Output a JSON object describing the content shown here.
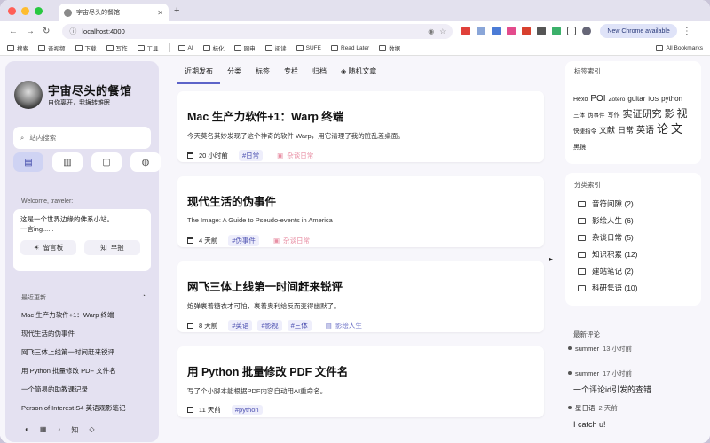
{
  "browser": {
    "tab_title": "宇宙尽头的餐馆",
    "url": "localhost:4000",
    "new_chrome_label": "New Chrome available",
    "lights": [
      "#ff5f57",
      "#febc2e",
      "#28c840"
    ],
    "bookmarks": [
      "搜索",
      "音视频",
      "下载",
      "写作",
      "工具",
      "AI",
      "标化",
      "网申",
      "阅读",
      "SUFE",
      "Read Later",
      "数据"
    ],
    "all_bookmarks": "All Bookmarks"
  },
  "sidebar": {
    "site_name": "宇宙尽头的餐馆",
    "site_sub": "自你离开，我辗转难眠",
    "search_placeholder": "站内搜索",
    "welcome": "Welcome, traveler:",
    "card_line1": "这是一个世界边缘的佛系小站。",
    "card_line2": "一言ing......",
    "btn_guestbook": "留言板",
    "btn_zhihu": "早报",
    "zhihu_icon_text": "知",
    "recent_title": "最近更新",
    "recent": [
      "Mac 生产力软件+1：Warp 终端",
      "现代生活的伪事件",
      "网飞三体上线第一时间赶来锐评",
      "用 Python 批量修改 PDF 文件名",
      "一个简易的助教课记录",
      "Person of Interest S4 英语观影笔记"
    ]
  },
  "tabs": [
    "近期发布",
    "分类",
    "标签",
    "专栏",
    "归档",
    "随机文章"
  ],
  "posts": [
    {
      "title": "Mac 生产力软件+1：Warp 终端",
      "desc": "今天莫名其妙发现了这个神奇的软件 Warp，用它清理了我的脏乱差桌面。",
      "time": "20 小时前",
      "tags": [
        "#日常"
      ],
      "category": "杂谈日常"
    },
    {
      "title": "现代生活的伪事件",
      "desc": "The Image: A Guide to Pseudo-events in America",
      "time": "4 天前",
      "tags": [
        "#伪事件"
      ],
      "category": "杂谈日常"
    },
    {
      "title": "网飞三体上线第一时间赶来锐评",
      "desc": "炮弹裹着糖衣才可怕，裹着奥利给反而变得幽默了。",
      "time": "8 天前",
      "tags": [
        "#英语",
        "#影视",
        "#三体"
      ],
      "category": "影绘人生"
    },
    {
      "title": "用 Python 批量修改 PDF 文件名",
      "desc": "写了个小脚本能根据PDF内容自动用AI重命名。",
      "time": "11 天前",
      "tags": [
        "#python"
      ],
      "category": ""
    }
  ],
  "tag_index": {
    "title": "标签索引",
    "tags": [
      {
        "t": "Hexo",
        "s": 7
      },
      {
        "t": "POI",
        "s": 10
      },
      {
        "t": "Zotero",
        "s": 6.5
      },
      {
        "t": "guitar",
        "s": 8
      },
      {
        "t": "iOS",
        "s": 7
      },
      {
        "t": "python",
        "s": 8
      },
      {
        "t": "三体",
        "s": 6.5
      },
      {
        "t": "伪事件",
        "s": 6.5
      },
      {
        "t": "写作",
        "s": 7
      },
      {
        "t": "实证研究",
        "s": 11
      },
      {
        "t": "影",
        "s": 11
      },
      {
        "t": "视",
        "s": 12
      },
      {
        "t": "快捷指令",
        "s": 6.5
      },
      {
        "t": "文献",
        "s": 9
      },
      {
        "t": "日常",
        "s": 9
      },
      {
        "t": "英语",
        "s": 10
      },
      {
        "t": "论",
        "s": 13
      },
      {
        "t": "文",
        "s": 13
      },
      {
        "t": "黑镜",
        "s": 7
      }
    ]
  },
  "category_index": {
    "title": "分类索引",
    "items": [
      "音符间隙 (2)",
      "影绘人生 (6)",
      "杂谈日常 (5)",
      "知识积累 (12)",
      "建站笔记 (2)",
      "科研隽语 (10)"
    ]
  },
  "comments": {
    "title": "最新评论",
    "items": [
      {
        "user": "summer",
        "time": "13 小时前",
        "text": ""
      },
      {
        "user": "summer",
        "time": "17 小时前",
        "text": "一个评论id引发的查错"
      },
      {
        "user": "星日语",
        "time": "2 天前",
        "text": "I catch u!"
      }
    ]
  }
}
